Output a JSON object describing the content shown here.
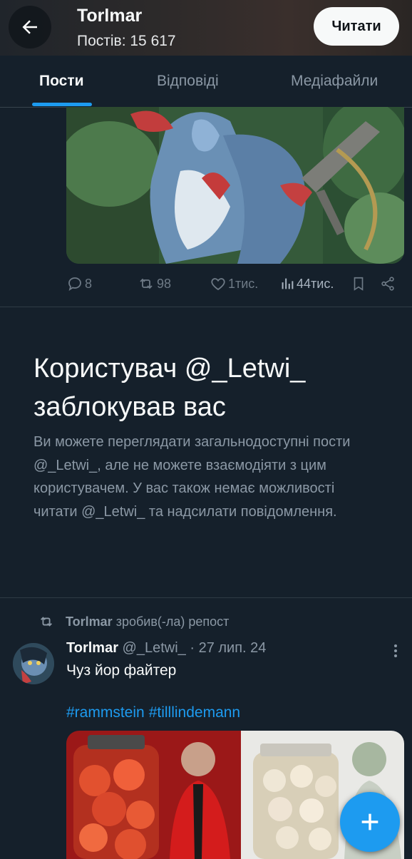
{
  "header": {
    "back_icon": "arrow-left-icon",
    "display_name": "Torlmar",
    "posts_count": "Постів: 15 617",
    "follow_label": "Читати"
  },
  "tabs": [
    {
      "label": "Пости",
      "active": true
    },
    {
      "label": "Відповіді",
      "active": false
    },
    {
      "label": "Медіафайли",
      "active": false
    }
  ],
  "post_actions": {
    "replies": "8",
    "reposts": "98",
    "likes": "1тис.",
    "views": "44тис."
  },
  "block_notice": {
    "title": "Користувач @_Letwi_ заблокував вас",
    "description": "Ви можете переглядати загальнодоступні пости @_Letwi_, але не можете взаємодіяти з цим користувачем. У вас також немає можливості читати @_Letwi_ та надсилати повідомлення."
  },
  "tweet": {
    "repost_by": "Torlmar",
    "repost_text": "зробив(-ла) репост",
    "author_name": "Torlmar",
    "author_handle": "@_Letwi_",
    "date": "· 27 лип. 24",
    "text": "Чуз йор файтер",
    "hashtags": [
      "#rammstein",
      "#tilllindemann"
    ]
  },
  "colors": {
    "accent": "#1d9bf0",
    "background": "#15202b",
    "muted": "#8b98a5"
  }
}
